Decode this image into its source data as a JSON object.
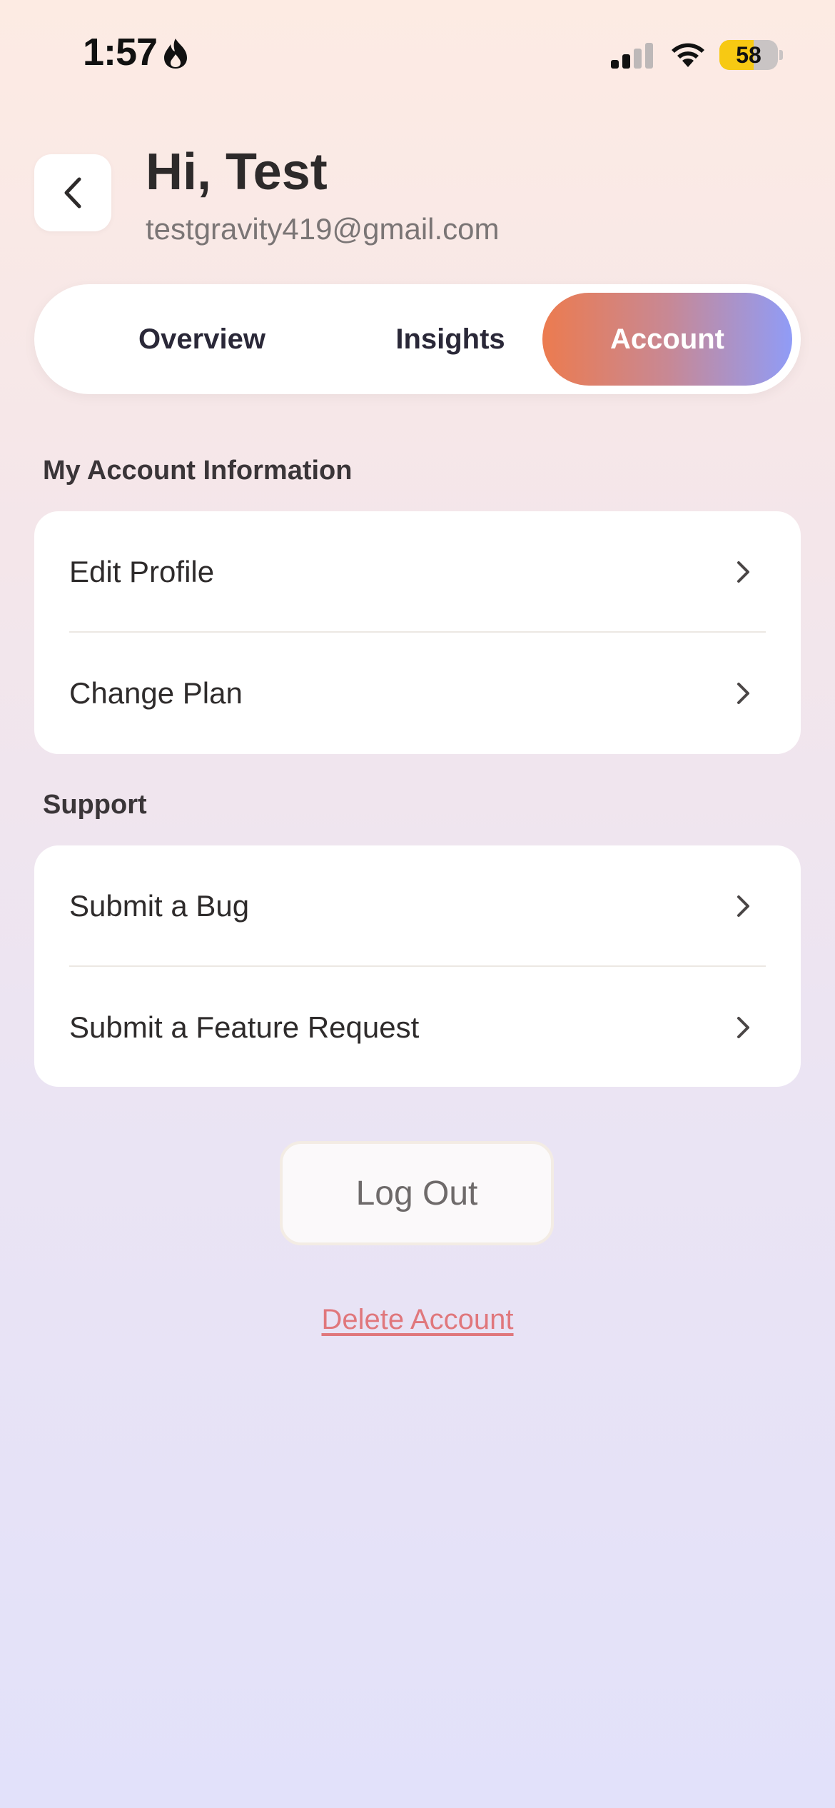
{
  "status_bar": {
    "time": "1:57",
    "battery_level": "58",
    "battery_percent": 58,
    "icons": [
      "focus-flame-icon",
      "cellular-signal-icon",
      "wifi-icon",
      "battery-icon"
    ]
  },
  "header": {
    "back_icon": "chevron-left-icon",
    "greeting": "Hi, Test",
    "email": "testgravity419@gmail.com"
  },
  "tabs": {
    "items": [
      {
        "label": "Overview",
        "active": false
      },
      {
        "label": "Insights",
        "active": false
      },
      {
        "label": "Account",
        "active": true
      }
    ],
    "active_gradient": [
      "#ec7b4f",
      "#909cf7"
    ]
  },
  "account_section": {
    "title": "My Account Information",
    "items": [
      {
        "label": "Edit Profile",
        "icon": "chevron-right-icon"
      },
      {
        "label": "Change Plan",
        "icon": "chevron-right-icon"
      }
    ]
  },
  "support_section": {
    "title": "Support",
    "items": [
      {
        "label": "Submit a Bug",
        "icon": "chevron-right-icon"
      },
      {
        "label": "Submit a Feature Request",
        "icon": "chevron-right-icon"
      }
    ]
  },
  "actions": {
    "logout_label": "Log Out",
    "delete_label": "Delete Account",
    "delete_color": "#e0777c"
  }
}
